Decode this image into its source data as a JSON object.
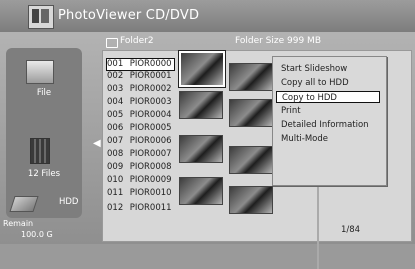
{
  "app": {
    "title": "PhotoViewer  CD/DVD"
  },
  "left_panel": {
    "file_label": "File",
    "count_label": "12 Files",
    "device_label": "HDD",
    "remain_label": "Remain",
    "remain_value": "100.0 G"
  },
  "folder": {
    "name": "Folder2",
    "size_label": "Folder Size 999 MB"
  },
  "files": [
    {
      "num": "001",
      "name": "PIOR0000"
    },
    {
      "num": "002",
      "name": "PIOR0001"
    },
    {
      "num": "003",
      "name": "PIOR0002"
    },
    {
      "num": "004",
      "name": "PIOR0003"
    },
    {
      "num": "005",
      "name": "PIOR0004"
    },
    {
      "num": "006",
      "name": "PIOR0005"
    },
    {
      "num": "007",
      "name": "PIOR0006"
    },
    {
      "num": "008",
      "name": "PIOR0007"
    },
    {
      "num": "009",
      "name": "PIOR0008"
    },
    {
      "num": "010",
      "name": "PIOR0009"
    },
    {
      "num": "011",
      "name": "PIOR0010"
    },
    {
      "num": "012",
      "name": "PIOR0011"
    }
  ],
  "page_indicator": "1/84",
  "context_menu": {
    "items": [
      {
        "label": "Start Slideshow"
      },
      {
        "label": "Copy all to HDD"
      },
      {
        "label": "Copy to HDD"
      },
      {
        "label": "Print"
      },
      {
        "label": "Detailed Information"
      },
      {
        "label": "Multi-Mode"
      }
    ],
    "selected_label": "Copy to HDD"
  },
  "selected_file": "PIOR0000"
}
